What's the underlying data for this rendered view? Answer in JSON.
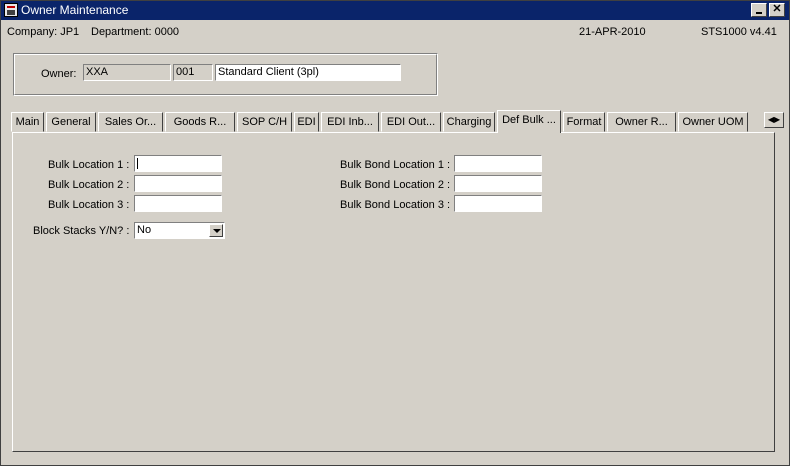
{
  "window": {
    "title": "Owner Maintenance"
  },
  "info": {
    "company": "Company:  JP1",
    "department": "Department:  0000",
    "date": "21-APR-2010",
    "version": "STS1000  v4.41"
  },
  "owner": {
    "label": "Owner:",
    "code": "XXA",
    "sub": "001",
    "name": "Standard Client (3pl)"
  },
  "tabs": [
    "Main",
    "General",
    "Sales Or...",
    "Goods R...",
    "SOP C/H",
    "EDI",
    "EDI Inb...",
    "EDI Out...",
    "Charging",
    "Def Bulk ...",
    "Format",
    "Owner R...",
    "Owner UOM"
  ],
  "form": {
    "bulk1": "Bulk Location 1 :",
    "bulk2": "Bulk Location 2 :",
    "bulk3": "Bulk Location 3 :",
    "bond1": "Bulk Bond Location 1 :",
    "bond2": "Bulk Bond Location 2 :",
    "bond3": "Bulk Bond Location 3 :",
    "block_label": "Block Stacks Y/N? :",
    "block_value": "No"
  }
}
